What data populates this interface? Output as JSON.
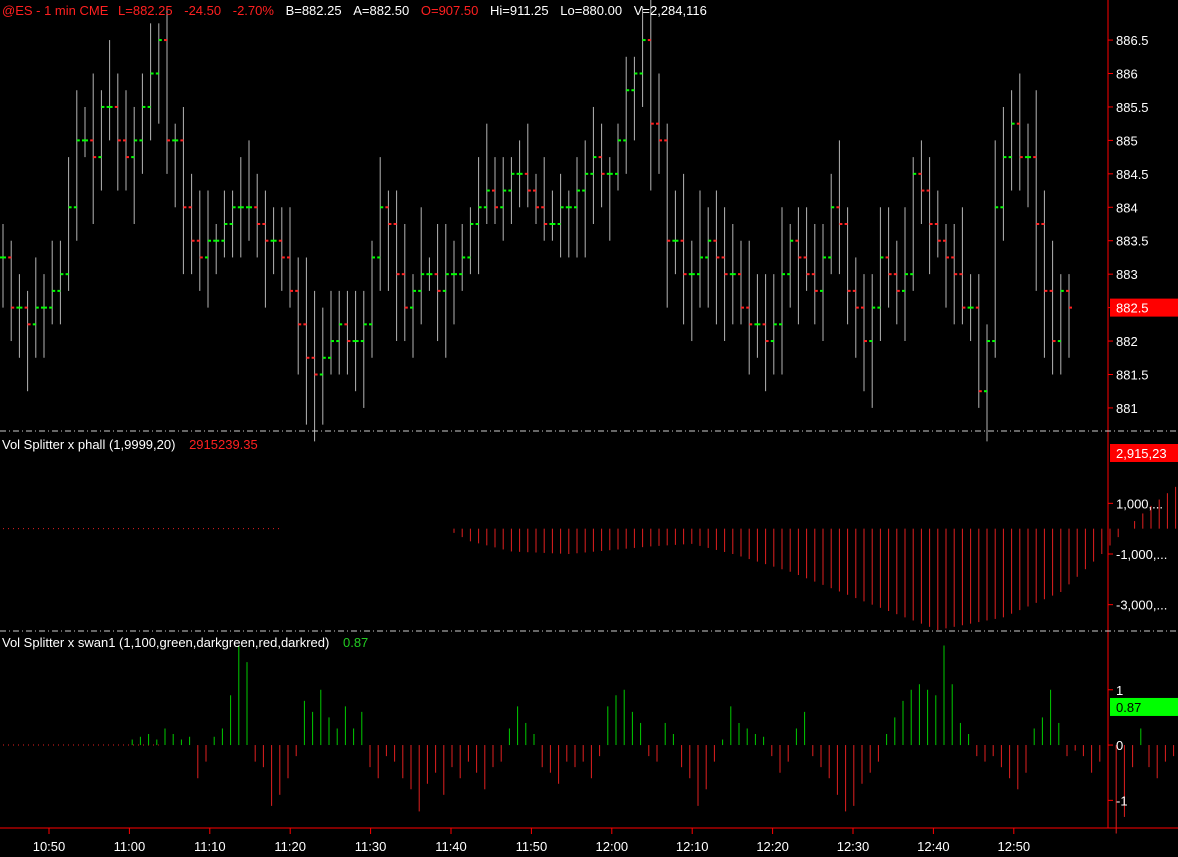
{
  "header": {
    "symbol": "@ES - 1 min  CME",
    "last": "L=882.25",
    "change": "-24.50",
    "change_pct": "-2.70%",
    "bid": "B=882.25",
    "ask": "A=882.50",
    "open": "O=907.50",
    "high": "Hi=911.25",
    "low": "Lo=880.00",
    "volume": "V=2,284,116"
  },
  "colors": {
    "up": "#00ff00",
    "down": "#ff2020",
    "bar": "#b4b4b4",
    "axis": "#ff0000",
    "volpos": "#00cc00",
    "volneg": "#e02020"
  },
  "panels": {
    "price": {
      "last_badge": "882.5"
    },
    "phall": {
      "label": "Vol Splitter x phall (1,9999,20)",
      "value": "2915239.35",
      "badge": "2,915,23"
    },
    "swan": {
      "label": "Vol Splitter x swan1 (1,100,green,darkgreen,red,darkred)",
      "value": "0.87",
      "badge": "0.87"
    }
  },
  "chart_data": [
    {
      "type": "ohlc",
      "ylim": [
        880.7,
        886.8
      ],
      "yticks": [
        "886.5",
        "886",
        "885.5",
        "885",
        "884.5",
        "884",
        "883.5",
        "883",
        "882.5",
        "882",
        "881.5",
        "881"
      ],
      "x_ticks": [
        "10:50",
        "11:00",
        "11:10",
        "11:20",
        "11:30",
        "11:40",
        "11:50",
        "12:00",
        "12:10",
        "12:20",
        "12:30",
        "12:40",
        "12:50"
      ],
      "bar_interval_minutes": 1,
      "close_path": [
        883.25,
        882.5,
        882.5,
        882.25,
        882.5,
        882.5,
        882.75,
        883,
        884,
        885,
        885,
        884.75,
        885.5,
        885.5,
        885,
        884.75,
        885,
        885.5,
        886,
        886.5,
        885,
        885,
        884,
        883.5,
        883.25,
        883.5,
        883.5,
        883.75,
        884,
        884,
        884,
        883.75,
        883.5,
        883.5,
        883.25,
        882.75,
        882.25,
        881.75,
        881.5,
        881.75,
        882,
        882.25,
        882,
        882,
        882.25,
        883.25,
        884,
        883.75,
        883,
        882.5,
        882.75,
        883,
        883,
        882.75,
        883,
        883,
        883.25,
        883.75,
        884,
        884.25,
        884,
        884.25,
        884.5,
        884.5,
        884.25,
        884,
        883.75,
        883.75,
        884,
        884,
        884.25,
        884.5,
        884.75,
        884.5,
        884.5,
        885,
        885.75,
        886,
        886.5,
        885.25,
        885,
        883.5,
        883.5,
        883,
        883,
        883.25,
        883.5,
        883.25,
        883,
        883,
        882.5,
        882.25,
        882.25,
        882,
        882.25,
        883,
        883.5,
        883.25,
        883,
        882.75,
        883.25,
        884,
        883.75,
        882.75,
        882.5,
        882,
        882.5,
        883.25,
        883,
        882.75,
        883,
        884.5,
        884.25,
        883.75,
        883.5,
        883.25,
        883,
        882.5,
        882.5,
        881.25,
        882,
        884,
        884.75,
        885.25,
        884.75,
        884.75,
        883.75,
        882.75,
        882,
        882.75,
        882.5
      ]
    },
    {
      "type": "bar",
      "name": "Vol Splitter x phall (1,9999,20)",
      "ylim": [
        -4000000,
        3500000
      ],
      "yticks": [
        "1,000,...",
        "-1,000,...",
        "-3,000,..."
      ],
      "last_value": 2915239.35,
      "path_points": [
        [
          0,
          0
        ],
        [
          20,
          0
        ],
        [
          23,
          -500000
        ],
        [
          28,
          -900000
        ],
        [
          35,
          -1000000
        ],
        [
          45,
          -700000
        ],
        [
          50,
          -600000
        ],
        [
          55,
          -1000000
        ],
        [
          62,
          -1700000
        ],
        [
          72,
          -3000000
        ],
        [
          80,
          -4000000
        ],
        [
          88,
          -3500000
        ],
        [
          95,
          -2500000
        ],
        [
          100,
          -1000000
        ],
        [
          103,
          0
        ],
        [
          106,
          900000
        ],
        [
          114,
          2900000
        ]
      ]
    },
    {
      "type": "bar",
      "name": "Vol Splitter x swan1 (1,100,green,darkgreen,red,darkred)",
      "ylim": [
        -1.5,
        1.9
      ],
      "yticks": [
        "1",
        "0",
        "-1"
      ],
      "last_value": 0.87,
      "values": [
        0,
        0,
        0,
        0,
        0,
        0,
        0,
        0,
        0,
        0,
        0,
        0,
        0,
        0,
        0,
        0,
        0.1,
        0.15,
        0.2,
        0.1,
        0.3,
        0.2,
        0.1,
        0.15,
        -0.6,
        -0.3,
        0.15,
        0.3,
        0.9,
        1.8,
        1.5,
        -0.3,
        -0.4,
        -1.1,
        -0.9,
        -0.6,
        -0.2,
        0.8,
        0.6,
        1.0,
        0.5,
        0.3,
        0.7,
        0.3,
        0.6,
        -0.4,
        -0.6,
        -0.2,
        -0.3,
        -0.6,
        -0.8,
        -1.2,
        -0.7,
        -0.5,
        -0.9,
        -0.4,
        -0.6,
        -0.3,
        -0.5,
        -0.8,
        -0.4,
        -0.3,
        0.3,
        0.7,
        0.4,
        0.2,
        -0.4,
        -0.5,
        -0.7,
        -0.3,
        -0.4,
        -0.3,
        -0.6,
        -0.2,
        0.7,
        0.9,
        1.0,
        0.6,
        0.4,
        -0.2,
        -0.3,
        0.4,
        0.2,
        -0.4,
        -0.6,
        -1.1,
        -0.8,
        -0.3,
        0.1,
        0.7,
        0.4,
        0.3,
        0.2,
        0.15,
        -0.2,
        -0.5,
        -0.3,
        0.3,
        0.6,
        -0.2,
        -0.4,
        -0.6,
        -0.9,
        -1.2,
        -1.1,
        -0.7,
        -0.5,
        -0.3,
        0.2,
        0.5,
        0.8,
        1.0,
        1.1,
        1.0,
        0.9,
        1.8,
        1.1,
        0.4,
        0.2,
        -0.2,
        -0.3,
        -0.2,
        -0.4,
        -0.6,
        -0.8,
        -0.5,
        0.3,
        0.5,
        1.0,
        0.4,
        -0.2,
        -0.1,
        -0.2,
        -0.5,
        -0.3,
        -1.0,
        -1.6,
        -1.3,
        -0.4,
        0.3,
        -0.4,
        -0.6,
        -0.3,
        -0.2,
        -0.1,
        0.4,
        0.87
      ]
    }
  ]
}
